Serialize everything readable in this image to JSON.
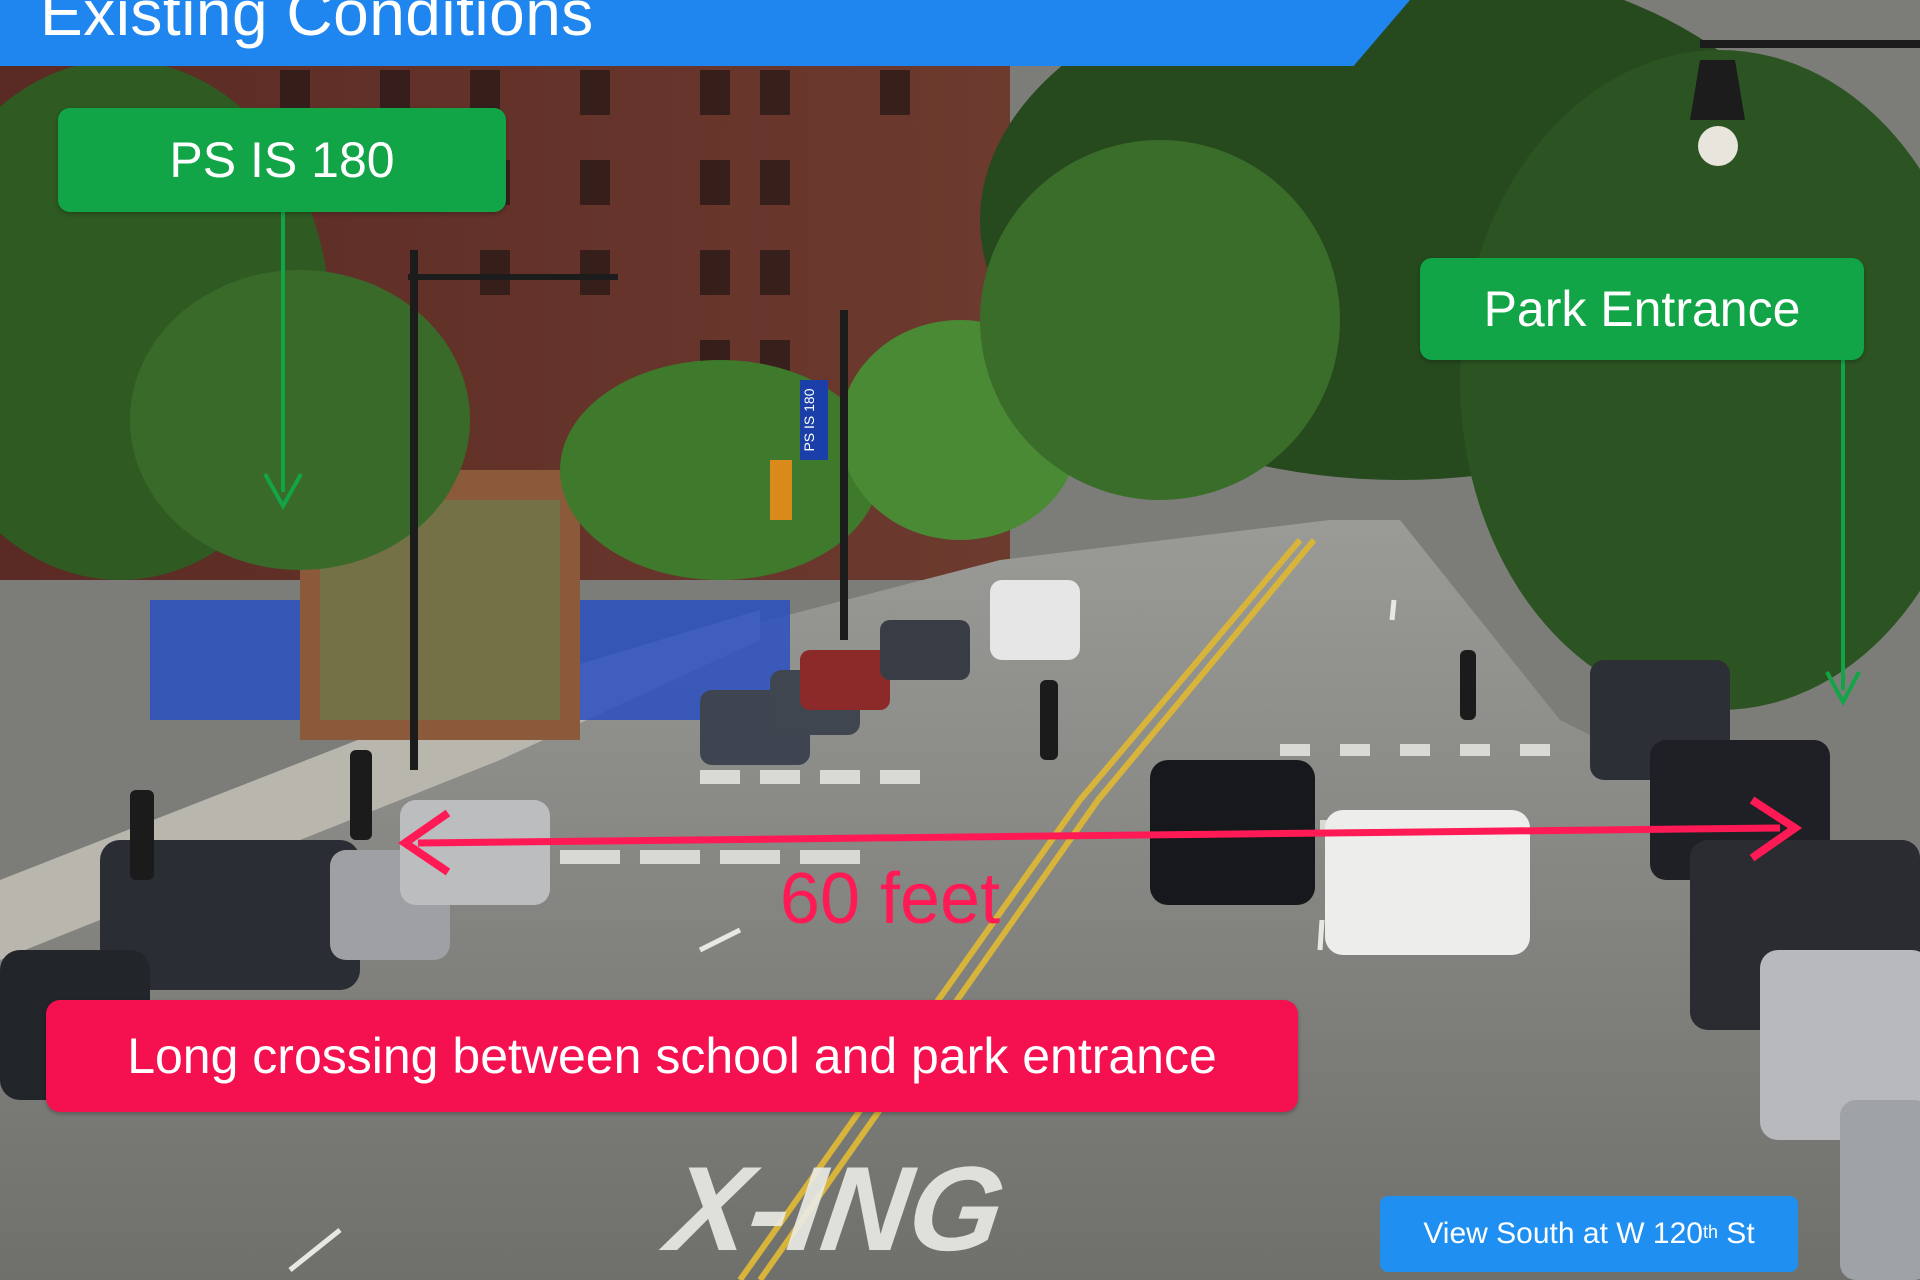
{
  "slide": {
    "title": "Existing Conditions"
  },
  "callouts": {
    "school": "PS IS 180",
    "park": "Park Entrance",
    "measurement": "60 feet",
    "issue": "Long crossing between school and park entrance"
  },
  "photo_caption": {
    "prefix": "View South at W 120",
    "suffix": "th",
    "rest": " St"
  },
  "scene_text": {
    "street_marking": "X-ING",
    "building_sign": "PS IS 180"
  },
  "colors": {
    "banner_blue": "#1f86f0",
    "callout_green": "#12a547",
    "callout_red": "#f5104f",
    "arrow_red": "#ff1a55",
    "caption_blue": "#1f8ff2"
  }
}
